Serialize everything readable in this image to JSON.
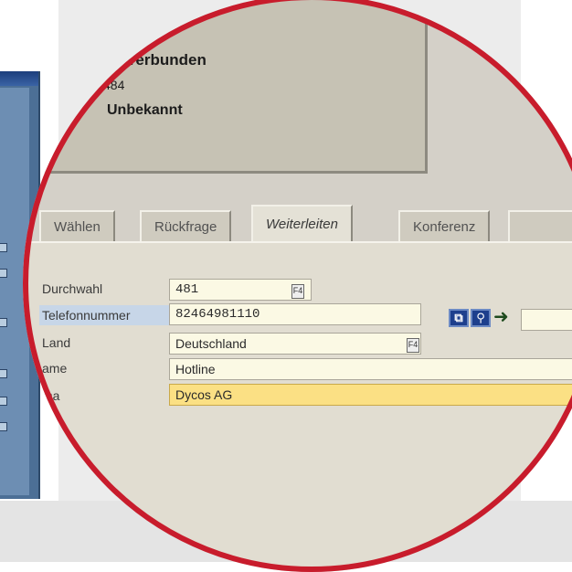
{
  "status": {
    "connection_state": "Verbunden",
    "extension": "484",
    "caller": "Unbekannt"
  },
  "tabs": [
    {
      "label": "Wählen",
      "active": false
    },
    {
      "label": "Rückfrage",
      "active": false
    },
    {
      "label": "Weiterleiten",
      "active": true
    },
    {
      "label": "Konferenz",
      "active": false
    }
  ],
  "form": {
    "fields": [
      {
        "label": "Durchwahl",
        "value": "481"
      },
      {
        "label": "Telefonnummer",
        "value": "82464981110"
      },
      {
        "label": "Land",
        "value": "Deutschland"
      },
      {
        "label": "ame",
        "value": "Hotline"
      },
      {
        "label": "ma",
        "value": "Dycos AG"
      }
    ]
  },
  "icons": {
    "f4_help": "F4",
    "copy": "⧉",
    "address_book": "⚲",
    "forward": "➜"
  },
  "colors": {
    "lens_ring": "#c81c2c",
    "highlight_field": "#fbe084",
    "input_field": "#fbf9e4",
    "selected_label": "#c7d6e8"
  }
}
